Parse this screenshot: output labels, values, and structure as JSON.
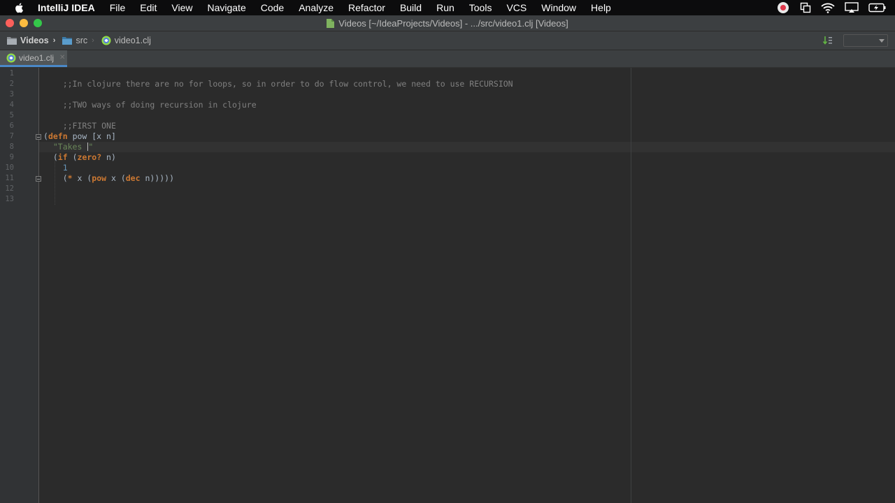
{
  "menubar": {
    "app_name": "IntelliJ IDEA",
    "items": [
      "File",
      "Edit",
      "View",
      "Navigate",
      "Code",
      "Analyze",
      "Refactor",
      "Build",
      "Run",
      "Tools",
      "VCS",
      "Window",
      "Help"
    ]
  },
  "titlebar": {
    "title": "Videos [~/IdeaProjects/Videos] - .../src/video1.clj [Videos]"
  },
  "navbar": {
    "project": "Videos",
    "folder": "src",
    "file": "video1.clj"
  },
  "tabs": [
    {
      "label": "video1.clj",
      "active": true
    }
  ],
  "editor": {
    "line_numbers": [
      "1",
      "2",
      "3",
      "4",
      "5",
      "6",
      "7",
      "8",
      "9",
      "10",
      "11",
      "12",
      "13"
    ],
    "comment1": ";;In clojure there are no for loops, so in order to do flow control, we need to use RECURSION",
    "comment2": ";;TWO ways of doing recursion in clojure",
    "comment3": ";;FIRST ONE",
    "l7_open": "(",
    "l7_kw": "defn",
    "l7_rest": " pow [x n]",
    "l8_indent": "  ",
    "l8_str_start": "\"Takes ",
    "l8_str_end": "\"",
    "l9_indent": "  (",
    "l9_kw1": "if",
    "l9_mid": " (",
    "l9_kw2": "zero?",
    "l9_rest": " n)",
    "l10_indent": "    ",
    "l10_num": "1",
    "l11_indent": "    (",
    "l11_kw1": "*",
    "l11_mid1": " x (",
    "l11_kw2": "pow",
    "l11_mid2": " x (",
    "l11_kw3": "dec",
    "l11_rest": " n)))))"
  },
  "colors": {
    "comment": "#808080",
    "keyword": "#cc7832",
    "string": "#6a8759",
    "number": "#6897bb",
    "tab_underline": "#4a88c7"
  }
}
